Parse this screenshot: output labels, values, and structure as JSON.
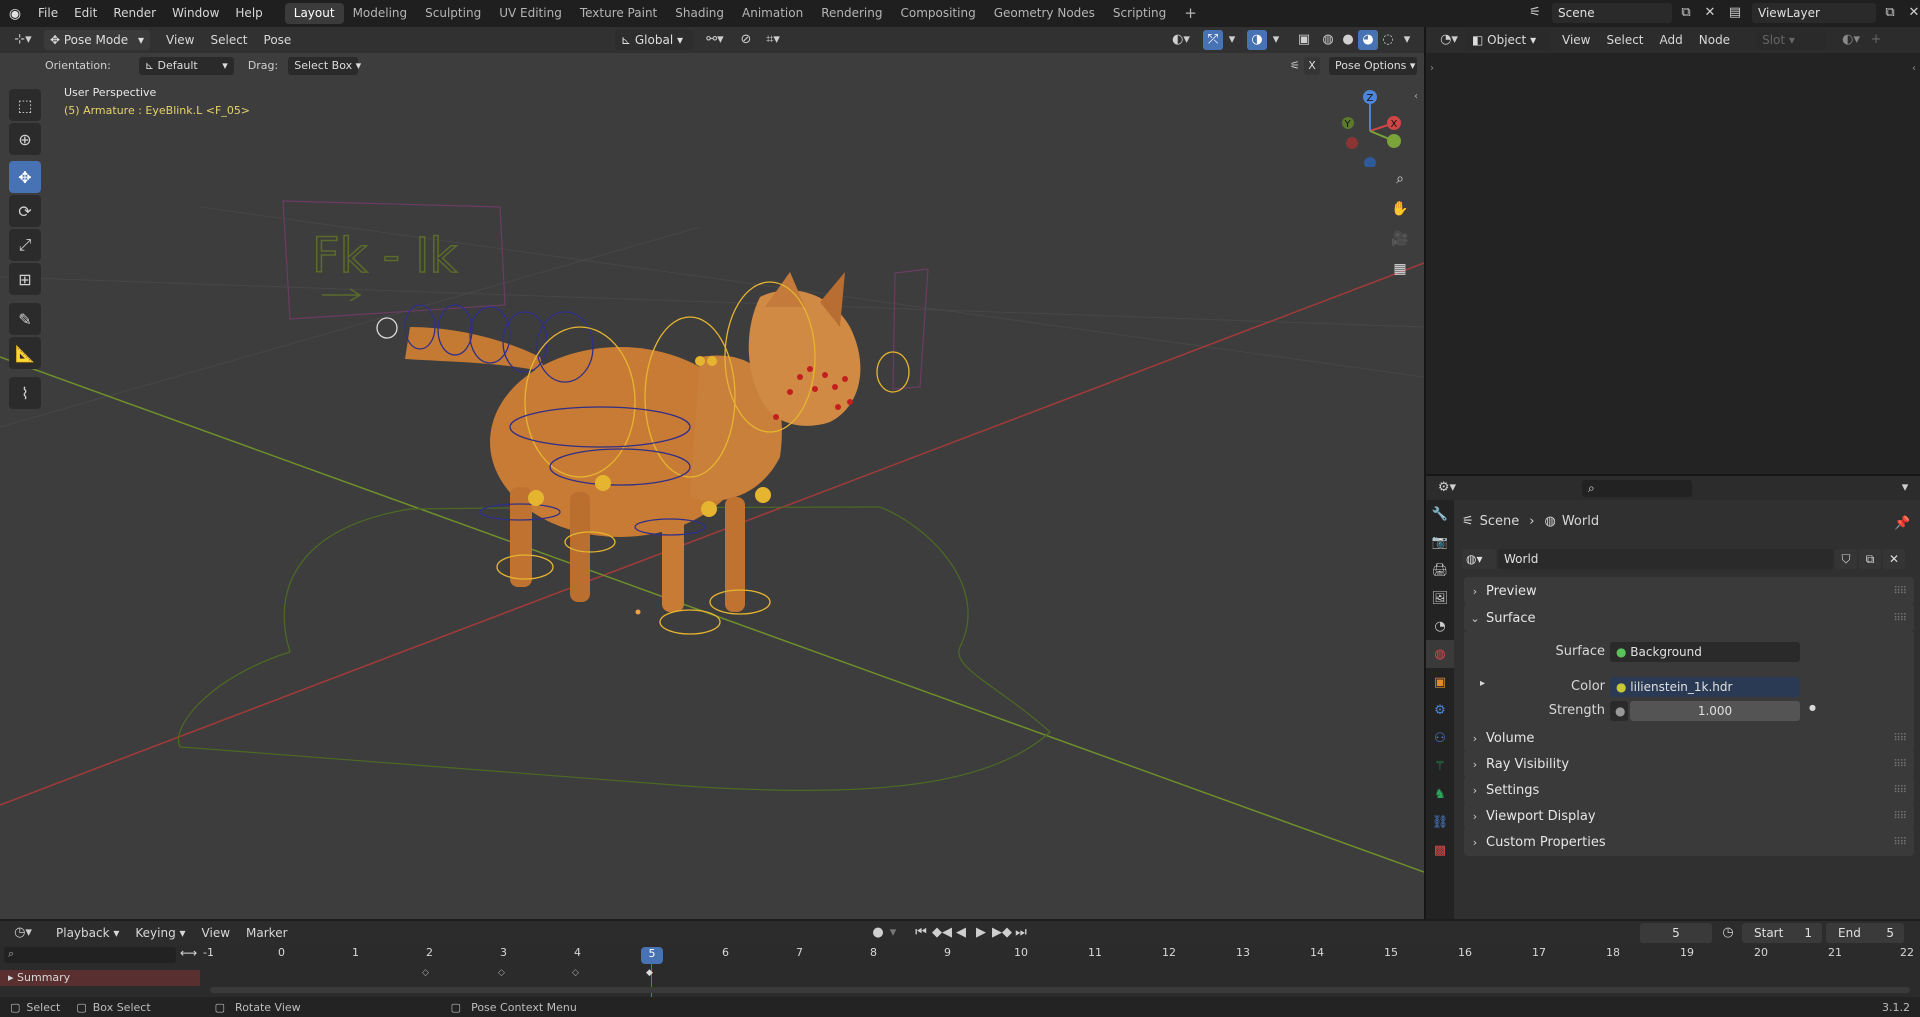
{
  "topbar": {
    "menus": [
      "File",
      "Edit",
      "Render",
      "Window",
      "Help"
    ],
    "workspaces": [
      "Layout",
      "Modeling",
      "Sculpting",
      "UV Editing",
      "Texture Paint",
      "Shading",
      "Animation",
      "Rendering",
      "Compositing",
      "Geometry Nodes",
      "Scripting"
    ],
    "active_workspace": "Layout",
    "add_workspace": "+",
    "scene": "Scene",
    "view_layer": "ViewLayer"
  },
  "viewport": {
    "mode": "Pose Mode",
    "menus": [
      "View",
      "Select",
      "Pose"
    ],
    "transform_orientation": "Global",
    "orientation_label": "Orientation:",
    "orientation_value": "Default",
    "drag_label": "Drag:",
    "drag_value": "Select Box",
    "pose_options": "Pose Options",
    "x_toggle": "X",
    "overlay_title": "User Perspective",
    "overlay_subtitle": "(5) Armature : EyeBlink.L <F_05>",
    "gizmo_labels": [
      "Z",
      "Y",
      "X"
    ],
    "sign_text": "Fk - Ik",
    "tools": [
      "select-box",
      "cursor",
      "move",
      "rotate",
      "scale",
      "transform",
      "annotate",
      "measure",
      "bone-envelope"
    ],
    "active_tool": "move"
  },
  "node_editor": {
    "type": "Object",
    "menus": [
      "View",
      "Select",
      "Add",
      "Node"
    ],
    "slot": "Slot"
  },
  "properties": {
    "breadcrumb_scene": "Scene",
    "breadcrumb_world": "World",
    "world_name": "World",
    "panels": {
      "preview": "Preview",
      "surface": "Surface",
      "volume": "Volume",
      "ray_visibility": "Ray Visibility",
      "settings": "Settings",
      "viewport_display": "Viewport Display",
      "custom_properties": "Custom Properties"
    },
    "surface_label": "Surface",
    "surface_value": "Background",
    "color_label": "Color",
    "color_value": "lilienstein_1k.hdr",
    "strength_label": "Strength",
    "strength_value": "1.000"
  },
  "timeline": {
    "menus": [
      "Playback",
      "Keying",
      "View",
      "Marker"
    ],
    "current_frame": "5",
    "start_label": "Start",
    "start_value": "1",
    "end_label": "End",
    "end_value": "5",
    "ruler": [
      "-1",
      "0",
      "1",
      "2",
      "3",
      "4",
      "5",
      "6",
      "7",
      "8",
      "9",
      "10",
      "11",
      "12",
      "13",
      "14",
      "15",
      "16",
      "17",
      "18",
      "19",
      "20",
      "21",
      "22"
    ],
    "summary": "Summary"
  },
  "statusbar": {
    "select": "Select",
    "box_select": "Box Select",
    "rotate_view": "Rotate View",
    "context_menu": "Pose Context Menu",
    "version": "3.1.2"
  },
  "colors": {
    "accent": "#4772b3",
    "viewport_bg": "#3d3d3d",
    "bone": "#e6b530",
    "text_yellow": "#e6d36a",
    "summary": "#5a2f2f"
  }
}
